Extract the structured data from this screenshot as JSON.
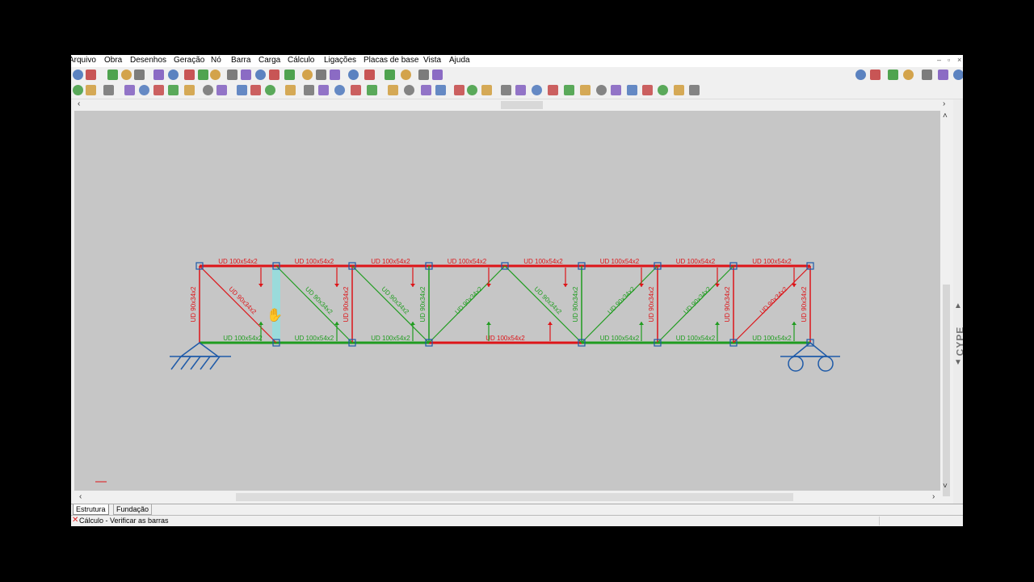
{
  "menu": [
    "Arquivo",
    "Obra",
    "Desenhos",
    "Geração",
    "Nó",
    "Barra",
    "Carga",
    "Cálculo",
    "Ligações",
    "Placas de base",
    "Vista",
    "Ajuda"
  ],
  "window_controls": {
    "minimize": "–",
    "restore": "▫",
    "close": "×"
  },
  "side_label": "CYPE",
  "tabs": {
    "structure": "Estrutura",
    "foundation": "Fundação"
  },
  "status": {
    "text": "Cálculo - Verificar as barras"
  },
  "colors": {
    "red": "#dd1418",
    "green": "#1f9c1f",
    "blue": "#1e5aa8",
    "canvas": "#c6c6c6",
    "highlight": "#8fe0e0"
  },
  "truss": {
    "top_chord": {
      "labels": [
        "UD 100x54x2",
        "UD 100x54x2",
        "UD 100x54x2",
        "UD 100x54x2",
        "UD 100x54x2",
        "UD 100x54x2",
        "UD 100x54x2",
        "UD 100x54x2"
      ],
      "status": [
        "red",
        "red",
        "red",
        "red",
        "red",
        "red",
        "red",
        "red"
      ]
    },
    "bottom_chord": {
      "labels": [
        "UD 100x54x2",
        "UD 100x54x2",
        "UD 100x54x2",
        "UD 100x54x2",
        "UD 100x54x2",
        "UD 100x54x2",
        "UD 100x54x2"
      ],
      "status": [
        "green",
        "green",
        "green",
        "red",
        "green",
        "green",
        "green"
      ]
    },
    "verticals": {
      "labels": [
        "UD 90x34x2",
        "UD 90x34x2",
        "UD 90x34x2",
        "UD 90x34x2",
        "UD 90x34x2",
        "UD 90x34x2",
        "UD 90x34x2"
      ],
      "status": [
        "red",
        "red",
        "red",
        "green",
        "green",
        "red",
        "red"
      ]
    },
    "diagonals": {
      "labels": [
        "UD 90x34x2",
        "UD 90x34x2",
        "UD 90x34x2",
        "UD 90x34x2",
        "UD 90x34x2",
        "UD 90x34x2",
        "UD 90x34x2",
        "UD 90x34x2"
      ],
      "status": [
        "red",
        "green",
        "green",
        "green",
        "green",
        "green",
        "green",
        "red"
      ]
    },
    "supports": [
      "pinned-support",
      "roller-support"
    ]
  }
}
